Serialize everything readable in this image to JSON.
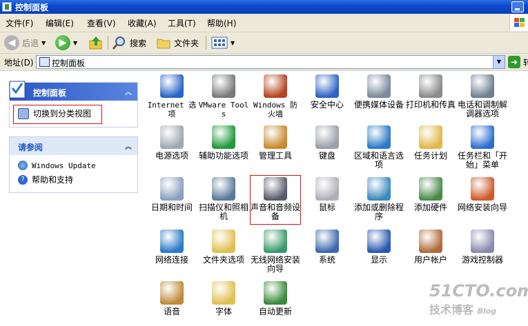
{
  "window": {
    "title": "控制面板"
  },
  "menu": [
    "文件(F)",
    "编辑(E)",
    "查看(V)",
    "收藏(A)",
    "工具(T)",
    "帮助(H)"
  ],
  "toolbar": {
    "back": "后退",
    "search": "搜索",
    "folders": "文件夹"
  },
  "address": {
    "label": "地址(D)",
    "value": "控制面板",
    "go": "转"
  },
  "left_panel": {
    "control_panel_title": "控制面板",
    "switch_view": "切换到分类视图",
    "see_also_title": "请参阅",
    "see_also_items": [
      "Windows Update",
      "帮助和支持"
    ]
  },
  "items": [
    {
      "label": "Internet 选项",
      "icon": "globe-check-icon",
      "color": "#2a66c9"
    },
    {
      "label": "VMware Tools",
      "icon": "vmware-icon",
      "color": "#7a7a7a"
    },
    {
      "label": "Windows 防火墙",
      "icon": "firewall-icon",
      "color": "#b5441f"
    },
    {
      "label": "安全中心",
      "icon": "shield-icon",
      "color": "#2e63c3"
    },
    {
      "label": "便携媒体设备",
      "icon": "media-device-icon",
      "color": "#7a8a9a"
    },
    {
      "label": "打印机和传真",
      "icon": "printer-icon",
      "color": "#8a8a8a"
    },
    {
      "label": "电话和调制解调器选项",
      "icon": "phone-icon",
      "color": "#6f7f8f"
    },
    {
      "label": "电源选项",
      "icon": "power-icon",
      "color": "#a0a8b0"
    },
    {
      "label": "辅助功能选项",
      "icon": "accessibility-icon",
      "color": "#1f9a3a"
    },
    {
      "label": "管理工具",
      "icon": "admin-tools-icon",
      "color": "#c98a2a"
    },
    {
      "label": "键盘",
      "icon": "keyboard-icon",
      "color": "#9aa0a8"
    },
    {
      "label": "区域和语言选项",
      "icon": "globe-icon",
      "color": "#2a7ac9"
    },
    {
      "label": "任务计划",
      "icon": "task-folder-icon",
      "color": "#e0b84a"
    },
    {
      "label": "任务栏和「开始」菜单",
      "icon": "taskbar-icon",
      "color": "#2f6fd0"
    },
    {
      "label": "日期和时间",
      "icon": "clock-icon",
      "color": "#8aa0c0"
    },
    {
      "label": "扫描仪和照相机",
      "icon": "scanner-icon",
      "color": "#5a7a9a"
    },
    {
      "label": "声音和音频设备",
      "icon": "speaker-icon",
      "color": "#5a5a6a"
    },
    {
      "label": "鼠标",
      "icon": "mouse-icon",
      "color": "#b0b0b8"
    },
    {
      "label": "添加或删除程序",
      "icon": "add-remove-icon",
      "color": "#3a8ac0"
    },
    {
      "label": "添加硬件",
      "icon": "hardware-icon",
      "color": "#4a8a4a"
    },
    {
      "label": "网络安装向导",
      "icon": "network-home-icon",
      "color": "#d05a2a"
    },
    {
      "label": "网络连接",
      "icon": "network-globe-icon",
      "color": "#2a7ac9"
    },
    {
      "label": "文件夹选项",
      "icon": "folder-options-icon",
      "color": "#e0c050"
    },
    {
      "label": "无线网络安装向导",
      "icon": "wireless-icon",
      "color": "#3a9a6a"
    },
    {
      "label": "系统",
      "icon": "system-icon",
      "color": "#3a6ab0"
    },
    {
      "label": "显示",
      "icon": "display-icon",
      "color": "#2a5ab0"
    },
    {
      "label": "用户帐户",
      "icon": "users-icon",
      "color": "#b06a3a"
    },
    {
      "label": "游戏控制器",
      "icon": "gamepad-icon",
      "color": "#8a8ab0"
    },
    {
      "label": "语音",
      "icon": "speech-icon",
      "color": "#c08a3a"
    },
    {
      "label": "字体",
      "icon": "fonts-folder-icon",
      "color": "#e0c050"
    },
    {
      "label": "自动更新",
      "icon": "auto-update-icon",
      "color": "#3a8a3a"
    }
  ],
  "watermark": {
    "site": "51CTO.com",
    "line2": "技术博客",
    "blog": "Blog"
  }
}
